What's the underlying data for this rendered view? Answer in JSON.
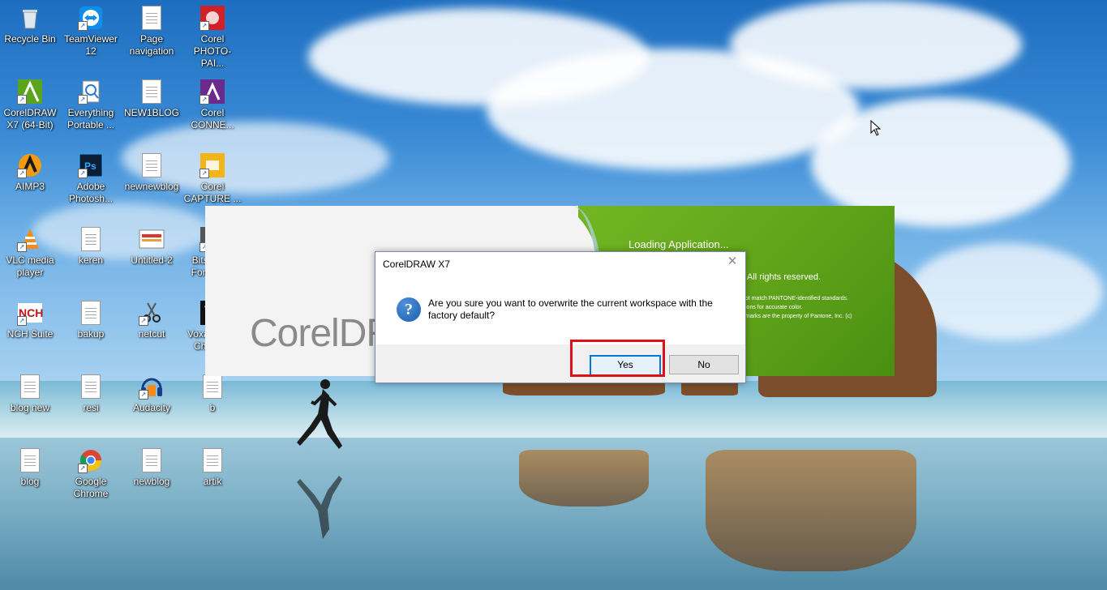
{
  "desktop": {
    "icons": [
      {
        "label": "Recycle Bin",
        "icon": "recycle-bin-icon"
      },
      {
        "label": "TeamViewer 12",
        "icon": "teamviewer-icon"
      },
      {
        "label": "Page navigation",
        "icon": "document-icon"
      },
      {
        "label": "Corel PHOTO-PAI...",
        "icon": "corel-photo-paint-icon"
      },
      {
        "label": "CorelDRAW X7 (64-Bit)",
        "icon": "coreldraw-icon"
      },
      {
        "label": "Everything Portable ...",
        "icon": "everything-search-icon"
      },
      {
        "label": "NEW1BLOG",
        "icon": "document-icon"
      },
      {
        "label": "Corel CONNE...",
        "icon": "corel-connect-icon"
      },
      {
        "label": "AIMP3",
        "icon": "aimp-icon"
      },
      {
        "label": "Adobe Photosh...",
        "icon": "photoshop-icon"
      },
      {
        "label": "newnewblog",
        "icon": "document-icon"
      },
      {
        "label": "Corel CAPTURE ...",
        "icon": "corel-capture-icon"
      },
      {
        "label": "VLC media player",
        "icon": "vlc-icon"
      },
      {
        "label": "keren",
        "icon": "document-icon"
      },
      {
        "label": "Untitled-2",
        "icon": "image-file-icon"
      },
      {
        "label": "Bitstream Font Na...",
        "icon": "bitstream-font-icon"
      },
      {
        "label": "NCH Suite",
        "icon": "nch-suite-icon"
      },
      {
        "label": "bakup",
        "icon": "document-icon"
      },
      {
        "label": "netcut",
        "icon": "netcut-icon"
      },
      {
        "label": "Voxal Voice Changer",
        "icon": "voxal-icon"
      },
      {
        "label": "blog new",
        "icon": "document-icon"
      },
      {
        "label": "resi",
        "icon": "document-icon"
      },
      {
        "label": "Audacity",
        "icon": "audacity-icon"
      },
      {
        "label": "b",
        "icon": "document-icon"
      },
      {
        "label": "blog",
        "icon": "document-icon"
      },
      {
        "label": "Google Chrome",
        "icon": "chrome-icon"
      },
      {
        "label": "newblog",
        "icon": "document-icon"
      },
      {
        "label": "artik",
        "icon": "document-icon"
      }
    ]
  },
  "splash": {
    "logo": "CorelDR",
    "loading": "Loading Application...",
    "rights": "All rights reserved.",
    "fine_print": [
      "ot match PANTONE-identified standards.",
      "ions for accurate color.",
      "marks are the property of Pantone, Inc. (c)"
    ]
  },
  "dialog": {
    "title": "CorelDRAW X7",
    "message": "Are you sure you want to overwrite the current workspace with the factory default?",
    "yes_label": "Yes",
    "no_label": "No",
    "close_symbol": "✕",
    "question_symbol": "?"
  },
  "colors": {
    "accent": "#0078d7",
    "highlight": "#e0101a",
    "corel_green": "#66ad1d"
  }
}
